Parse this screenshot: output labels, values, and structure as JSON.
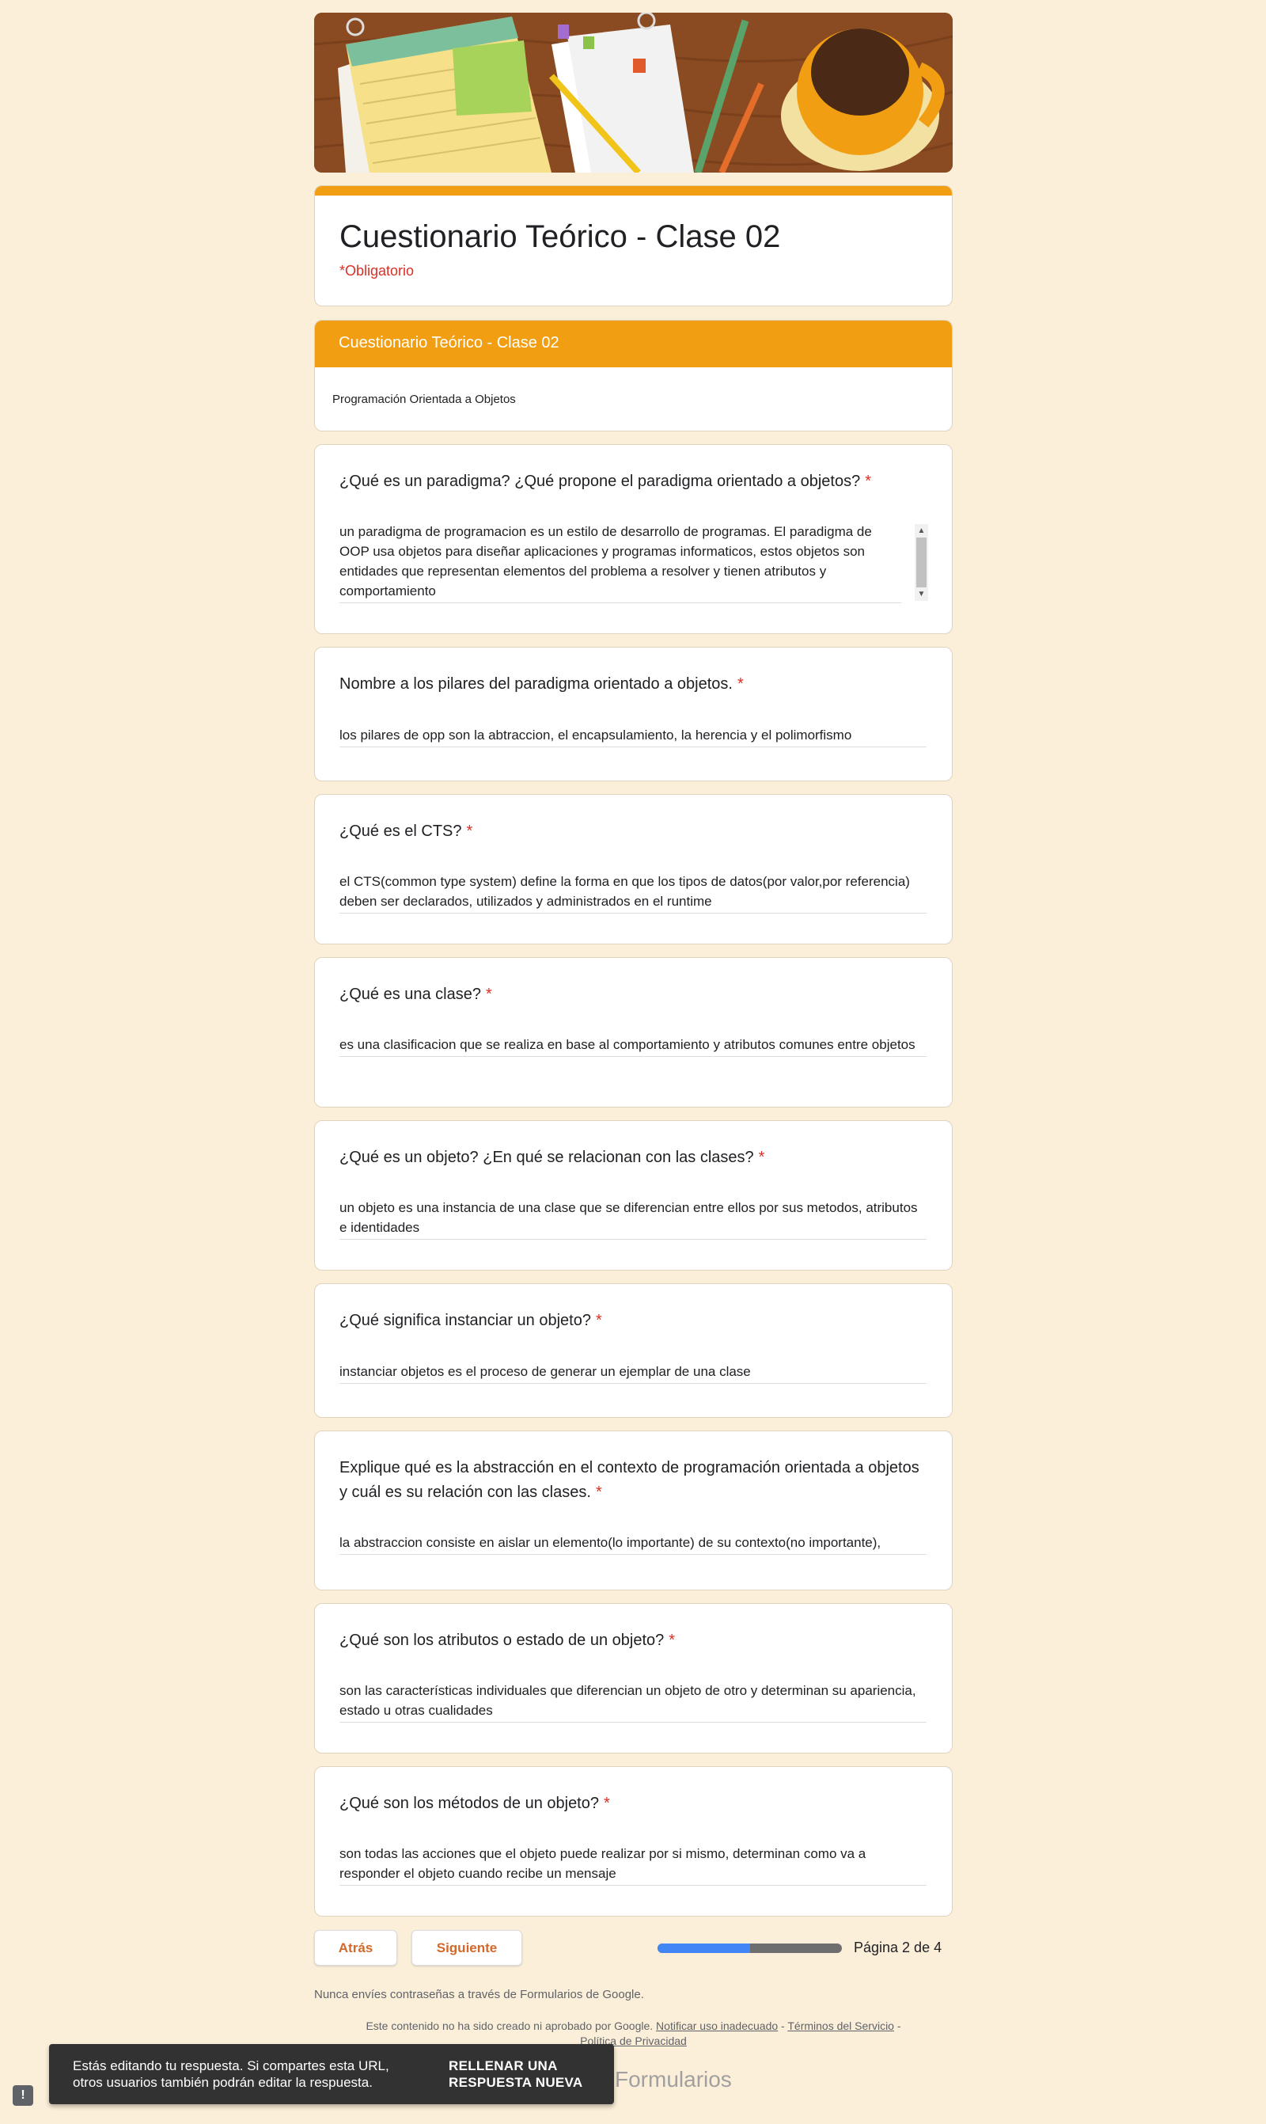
{
  "form": {
    "title": "Cuestionario Teórico - Clase 02",
    "required_note": "*Obligatorio"
  },
  "section": {
    "title": "Cuestionario Teórico - Clase 02",
    "description": "Programación Orientada a Objetos"
  },
  "required_marker": "*",
  "questions": [
    {
      "title": "¿Qué es un paradigma? ¿Qué propone el paradigma orientado a objetos?",
      "answer": "un paradigma de programacion es un estilo de desarrollo de programas. El paradigma de OOP usa objetos para diseñar aplicaciones y programas informaticos, estos objetos son entidades que representan elementos del problema a resolver y tienen atributos y comportamiento"
    },
    {
      "title": "Nombre a los pilares del paradigma orientado a objetos.",
      "answer": "los pilares de opp son la abtraccion, el encapsulamiento, la herencia y el polimorfismo"
    },
    {
      "title": "¿Qué es el CTS?",
      "answer": "el CTS(common type system) define la forma en que los tipos de datos(por valor,por referencia) deben ser declarados, utilizados y administrados en el runtime"
    },
    {
      "title": "¿Qué es una clase?",
      "answer": "es una clasificacion que se realiza en base al comportamiento y atributos comunes entre objetos"
    },
    {
      "title": "¿Qué es un objeto? ¿En qué se relacionan con las clases?",
      "answer": "un objeto es una instancia de una clase que se diferencian entre ellos por sus metodos, atributos e identidades"
    },
    {
      "title": "¿Qué significa instanciar un objeto?",
      "answer": "instanciar objetos es el proceso de generar un ejemplar de una clase"
    },
    {
      "title": "Explique qué es la abstracción en el contexto de programación orientada a objetos y cuál es su relación con las clases.",
      "answer": "la abstraccion consiste en aislar un elemento(lo importante) de su contexto(no importante),"
    },
    {
      "title": "¿Qué son los atributos o estado de un objeto?",
      "answer": "son las características individuales que diferencian un objeto de otro y determinan su apariencia, estado u otras cualidades"
    },
    {
      "title": "¿Qué son los métodos de un objeto?",
      "answer": "son todas las acciones que el objeto puede realizar por si mismo, determinan como va a responder el objeto cuando recibe un mensaje"
    }
  ],
  "navigation": {
    "back_label": "Atrás",
    "next_label": "Siguiente",
    "page_label": "Página 2 de 4",
    "progress": 0.5
  },
  "footer": {
    "password_note": "Nunca envíes contraseñas a través de Formularios de Google.",
    "disclaimer": "Este contenido no ha sido creado ni aprobado por Google.",
    "report_link": "Notificar uso inadecuado",
    "separator": "-",
    "terms_link": "Términos del Servicio",
    "privacy_link": "Política de Privacidad",
    "brand": "Formularios"
  },
  "snackbar": {
    "message": "Estás editando tu respuesta. Si compartes esta URL, otros usuarios también podrán editar la respuesta.",
    "action": "RELLENAR UNA RESPUESTA NUEVA"
  },
  "feedback_button": "!",
  "colors": {
    "page_background": "#fcefd9",
    "accent": "#f29e12",
    "required": "#d93025",
    "button_text": "#d2692a",
    "progress_fill": "#4285f4",
    "progress_track": "#6e6e6e"
  }
}
